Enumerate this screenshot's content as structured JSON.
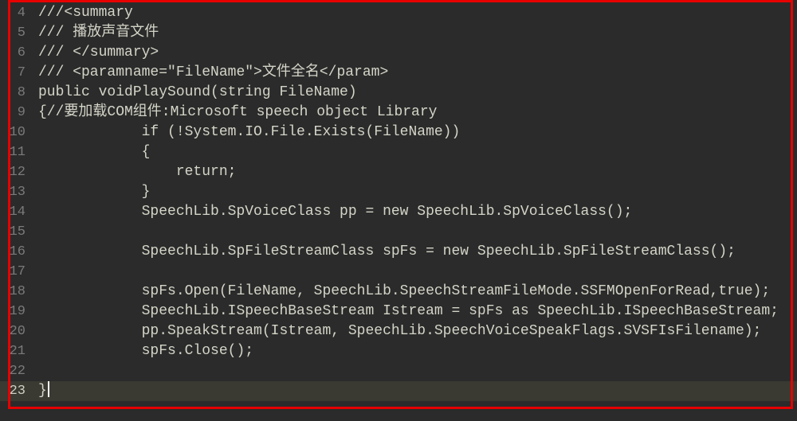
{
  "editor": {
    "language": "csharp",
    "firstLineNumber": 4,
    "highlightedLineIndex": 19,
    "lines": [
      "///<summary",
      "/// 播放声音文件",
      "/// </summary>",
      "/// <paramname=\"FileName\">文件全名</param>",
      "public voidPlaySound(string FileName)",
      "{//要加载COM组件:Microsoft speech object Library",
      "            if (!System.IO.File.Exists(FileName))",
      "            {",
      "                return;",
      "            }",
      "            SpeechLib.SpVoiceClass pp = new SpeechLib.SpVoiceClass();",
      "",
      "            SpeechLib.SpFileStreamClass spFs = new SpeechLib.SpFileStreamClass();",
      "",
      "            spFs.Open(FileName, SpeechLib.SpeechStreamFileMode.SSFMOpenForRead,true);",
      "            SpeechLib.ISpeechBaseStream Istream = spFs as SpeechLib.ISpeechBaseStream;",
      "            pp.SpeakStream(Istream, SpeechLib.SpeechVoiceSpeakFlags.SVSFIsFilename);",
      "            spFs.Close();",
      "",
      "}"
    ]
  },
  "annotation": {
    "border_color": "#e60000"
  }
}
